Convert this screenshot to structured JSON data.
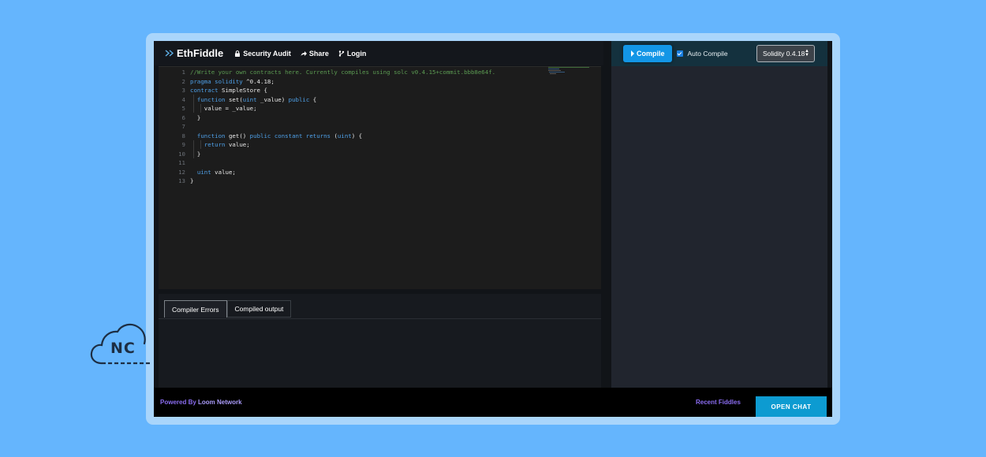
{
  "app": {
    "title": "EthFiddle",
    "nav": [
      {
        "label": "Security Audit",
        "icon": "lock-icon"
      },
      {
        "label": "Share",
        "icon": "share-icon"
      },
      {
        "label": "Login",
        "icon": "git-branch-icon"
      }
    ]
  },
  "toolbar": {
    "compile_label": "Compile",
    "auto_compile_label": "Auto Compile",
    "auto_compile_checked": true,
    "version_selected": "Solidity 0.4.18"
  },
  "editor": {
    "line_numbers": [
      "1",
      "2",
      "3",
      "4",
      "5",
      "6",
      "7",
      "8",
      "9",
      "10",
      "11",
      "12",
      "13"
    ],
    "lines": {
      "l1": "//Write your own contracts here. Currently compiles using solc v0.4.15+commit.bbb8e64f.",
      "l2_kw": "pragma solidity",
      "l2_rest": " ^0.4.18;",
      "l3_kw": "contract",
      "l3_rest": " SimpleStore {",
      "l4_kw1": "function",
      "l4_mid1": " set(",
      "l4_kw2": "uint",
      "l4_mid2": " _value) ",
      "l4_kw3": "public",
      "l4_end": " {",
      "l5": "    value = _value;",
      "l6": "  }",
      "l8_kw1": "function",
      "l8_mid1": " get() ",
      "l8_kw2": "public constant returns",
      "l8_mid2": " (",
      "l8_kw3": "uint",
      "l8_end": ") {",
      "l9_kw": "return",
      "l9_rest": " value;",
      "l10": "  }",
      "l12_kw": "uint",
      "l12_rest": " value;",
      "l13": "}"
    }
  },
  "output": {
    "tabs": [
      "Compiler Errors",
      "Compiled output"
    ],
    "active_tab": "Compiler Errors"
  },
  "footer": {
    "powered_prefix": "Powered By ",
    "powered_brand": "Loom Network",
    "recent_label": "Recent Fiddles",
    "chat_label": "OPEN CHAT"
  },
  "badge": {
    "text": "NC"
  },
  "colors": {
    "page_bg": "#65b5fd",
    "frame": "#a9d5fb",
    "compile_button": "#1396e6",
    "open_chat": "#0d9bd1",
    "link_purple": "#8a6cf0",
    "keyword": "#4ea0e8",
    "comment": "#5b9a52"
  }
}
